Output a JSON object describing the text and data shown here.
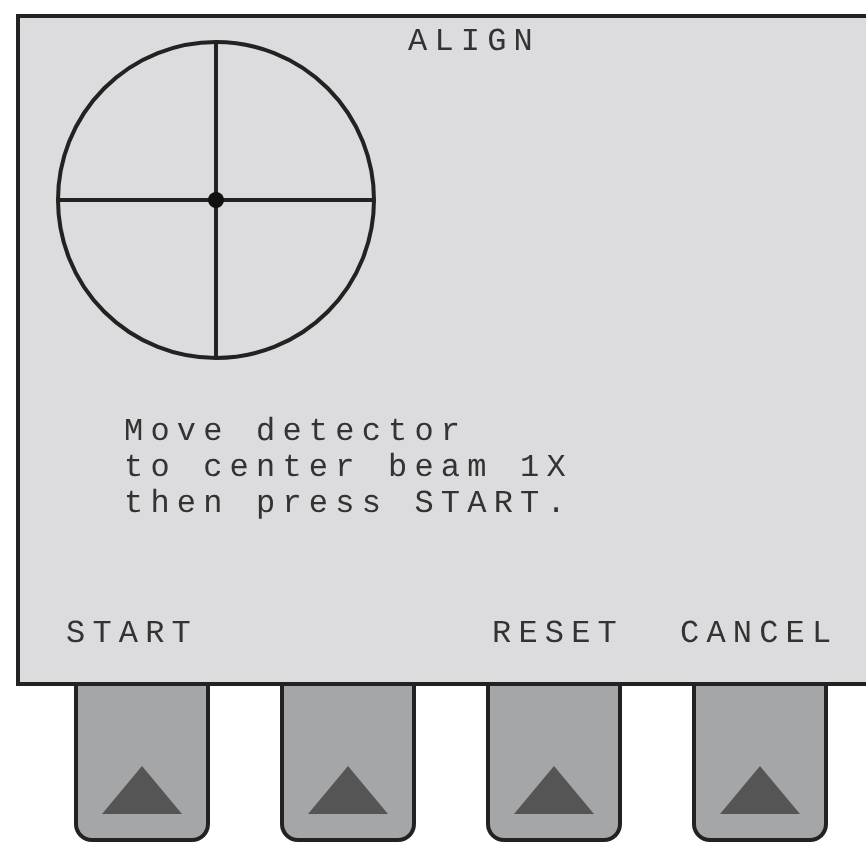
{
  "screen": {
    "title": "ALIGN",
    "message": [
      "Move detector",
      "to center beam 1X",
      "then press START."
    ]
  },
  "softkeys": [
    {
      "kind": "labeled",
      "label": "START"
    },
    {
      "kind": "blank"
    },
    {
      "kind": "labeled",
      "label": "RESET"
    },
    {
      "kind": "labeled",
      "label": "CANCEL"
    }
  ]
}
